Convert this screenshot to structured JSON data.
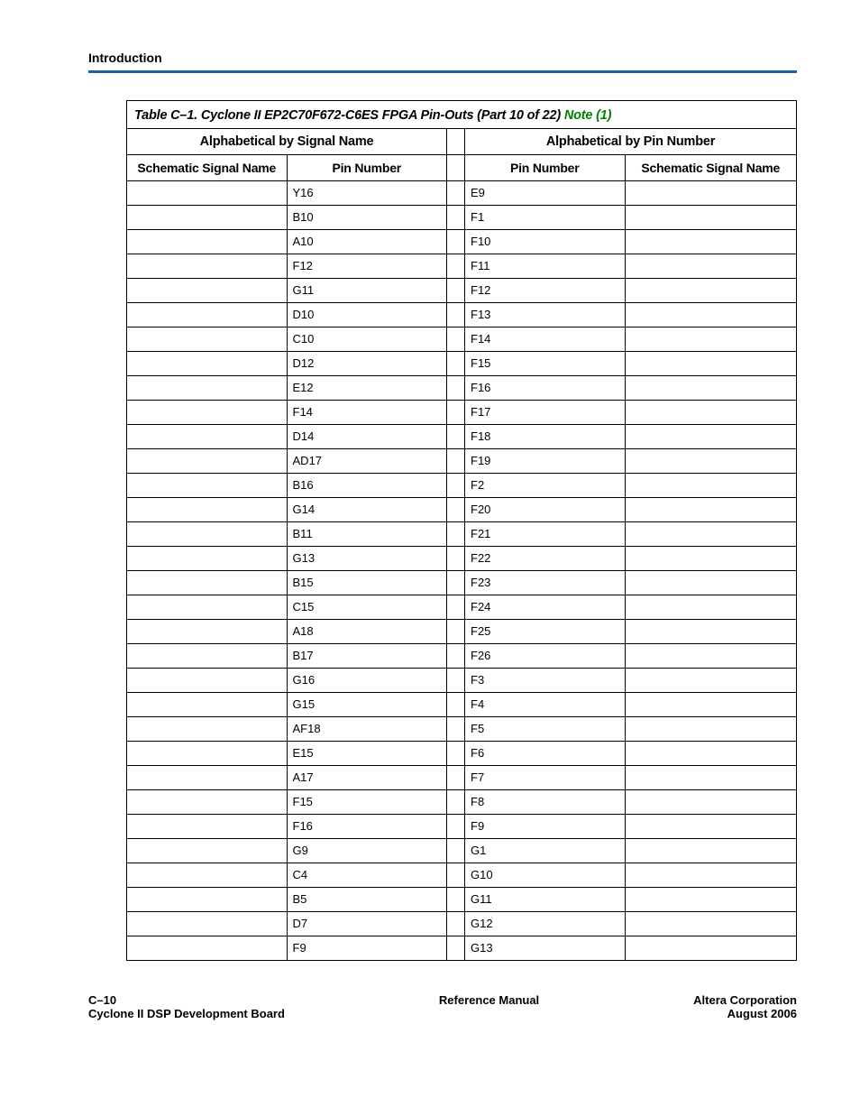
{
  "header": {
    "section": "Introduction"
  },
  "table": {
    "caption_main": "Table C–1. Cyclone II EP2C70F672-C6ES FPGA Pin-Outs  (Part 10 of 22) ",
    "caption_note": "Note (1)",
    "group_left": "Alphabetical by Signal Name",
    "group_right": "Alphabetical by Pin Number",
    "col1": "Schematic Signal Name",
    "col2": "Pin Number",
    "col3": "Pin Number",
    "col4": "Schematic Signal Name",
    "rows": [
      {
        "sig_l": "",
        "pin_l": "Y16",
        "pin_r": "E9",
        "sig_r": ""
      },
      {
        "sig_l": "",
        "pin_l": "B10",
        "pin_r": "F1",
        "sig_r": ""
      },
      {
        "sig_l": "",
        "pin_l": "A10",
        "pin_r": "F10",
        "sig_r": ""
      },
      {
        "sig_l": "",
        "pin_l": "F12",
        "pin_r": "F11",
        "sig_r": ""
      },
      {
        "sig_l": "",
        "pin_l": "G11",
        "pin_r": "F12",
        "sig_r": ""
      },
      {
        "sig_l": "",
        "pin_l": "D10",
        "pin_r": "F13",
        "sig_r": ""
      },
      {
        "sig_l": "",
        "pin_l": "C10",
        "pin_r": "F14",
        "sig_r": ""
      },
      {
        "sig_l": "",
        "pin_l": "D12",
        "pin_r": "F15",
        "sig_r": ""
      },
      {
        "sig_l": "",
        "pin_l": "E12",
        "pin_r": "F16",
        "sig_r": ""
      },
      {
        "sig_l": "",
        "pin_l": "F14",
        "pin_r": "F17",
        "sig_r": ""
      },
      {
        "sig_l": "",
        "pin_l": "D14",
        "pin_r": "F18",
        "sig_r": ""
      },
      {
        "sig_l": "",
        "pin_l": "AD17",
        "pin_r": "F19",
        "sig_r": ""
      },
      {
        "sig_l": "",
        "pin_l": "B16",
        "pin_r": "F2",
        "sig_r": ""
      },
      {
        "sig_l": "",
        "pin_l": "G14",
        "pin_r": "F20",
        "sig_r": ""
      },
      {
        "sig_l": "",
        "pin_l": "B11",
        "pin_r": "F21",
        "sig_r": ""
      },
      {
        "sig_l": "",
        "pin_l": "G13",
        "pin_r": "F22",
        "sig_r": ""
      },
      {
        "sig_l": "",
        "pin_l": "B15",
        "pin_r": "F23",
        "sig_r": ""
      },
      {
        "sig_l": "",
        "pin_l": "C15",
        "pin_r": "F24",
        "sig_r": ""
      },
      {
        "sig_l": "",
        "pin_l": "A18",
        "pin_r": "F25",
        "sig_r": ""
      },
      {
        "sig_l": "",
        "pin_l": "B17",
        "pin_r": "F26",
        "sig_r": ""
      },
      {
        "sig_l": "",
        "pin_l": "G16",
        "pin_r": "F3",
        "sig_r": ""
      },
      {
        "sig_l": "",
        "pin_l": "G15",
        "pin_r": "F4",
        "sig_r": ""
      },
      {
        "sig_l": "",
        "pin_l": "AF18",
        "pin_r": "F5",
        "sig_r": ""
      },
      {
        "sig_l": "",
        "pin_l": "E15",
        "pin_r": "F6",
        "sig_r": ""
      },
      {
        "sig_l": "",
        "pin_l": "A17",
        "pin_r": "F7",
        "sig_r": ""
      },
      {
        "sig_l": "",
        "pin_l": "F15",
        "pin_r": "F8",
        "sig_r": ""
      },
      {
        "sig_l": "",
        "pin_l": "F16",
        "pin_r": "F9",
        "sig_r": ""
      },
      {
        "sig_l": "",
        "pin_l": "G9",
        "pin_r": "G1",
        "sig_r": ""
      },
      {
        "sig_l": "",
        "pin_l": "C4",
        "pin_r": "G10",
        "sig_r": ""
      },
      {
        "sig_l": "",
        "pin_l": "B5",
        "pin_r": "G11",
        "sig_r": ""
      },
      {
        "sig_l": "",
        "pin_l": "D7",
        "pin_r": "G12",
        "sig_r": ""
      },
      {
        "sig_l": "",
        "pin_l": "F9",
        "pin_r": "G13",
        "sig_r": ""
      }
    ]
  },
  "chart_data": {
    "type": "table",
    "title": "Table C–1. Cyclone II EP2C70F672-C6ES FPGA Pin-Outs (Part 10 of 22)",
    "columns_left": [
      "Schematic Signal Name",
      "Pin Number"
    ],
    "columns_right": [
      "Pin Number",
      "Schematic Signal Name"
    ],
    "left_rows": [
      [
        "",
        "Y16"
      ],
      [
        "",
        "B10"
      ],
      [
        "",
        "A10"
      ],
      [
        "",
        "F12"
      ],
      [
        "",
        "G11"
      ],
      [
        "",
        "D10"
      ],
      [
        "",
        "C10"
      ],
      [
        "",
        "D12"
      ],
      [
        "",
        "E12"
      ],
      [
        "",
        "F14"
      ],
      [
        "",
        "D14"
      ],
      [
        "",
        "AD17"
      ],
      [
        "",
        "B16"
      ],
      [
        "",
        "G14"
      ],
      [
        "",
        "B11"
      ],
      [
        "",
        "G13"
      ],
      [
        "",
        "B15"
      ],
      [
        "",
        "C15"
      ],
      [
        "",
        "A18"
      ],
      [
        "",
        "B17"
      ],
      [
        "",
        "G16"
      ],
      [
        "",
        "G15"
      ],
      [
        "",
        "AF18"
      ],
      [
        "",
        "E15"
      ],
      [
        "",
        "A17"
      ],
      [
        "",
        "F15"
      ],
      [
        "",
        "F16"
      ],
      [
        "",
        "G9"
      ],
      [
        "",
        "C4"
      ],
      [
        "",
        "B5"
      ],
      [
        "",
        "D7"
      ],
      [
        "",
        "F9"
      ]
    ],
    "right_rows": [
      [
        "E9",
        ""
      ],
      [
        "F1",
        ""
      ],
      [
        "F10",
        ""
      ],
      [
        "F11",
        ""
      ],
      [
        "F12",
        ""
      ],
      [
        "F13",
        ""
      ],
      [
        "F14",
        ""
      ],
      [
        "F15",
        ""
      ],
      [
        "F16",
        ""
      ],
      [
        "F17",
        ""
      ],
      [
        "F18",
        ""
      ],
      [
        "F19",
        ""
      ],
      [
        "F2",
        ""
      ],
      [
        "F20",
        ""
      ],
      [
        "F21",
        ""
      ],
      [
        "F22",
        ""
      ],
      [
        "F23",
        ""
      ],
      [
        "F24",
        ""
      ],
      [
        "F25",
        ""
      ],
      [
        "F26",
        ""
      ],
      [
        "F3",
        ""
      ],
      [
        "F4",
        ""
      ],
      [
        "F5",
        ""
      ],
      [
        "F6",
        ""
      ],
      [
        "F7",
        ""
      ],
      [
        "F8",
        ""
      ],
      [
        "F9",
        ""
      ],
      [
        "G1",
        ""
      ],
      [
        "G10",
        ""
      ],
      [
        "G11",
        ""
      ],
      [
        "G12",
        ""
      ],
      [
        "G13",
        ""
      ]
    ]
  },
  "footer": {
    "page_no": "C–10",
    "left_sub": "Cyclone II DSP Development Board",
    "center": "Reference Manual",
    "right_top": "Altera Corporation",
    "right_sub": "August 2006"
  }
}
